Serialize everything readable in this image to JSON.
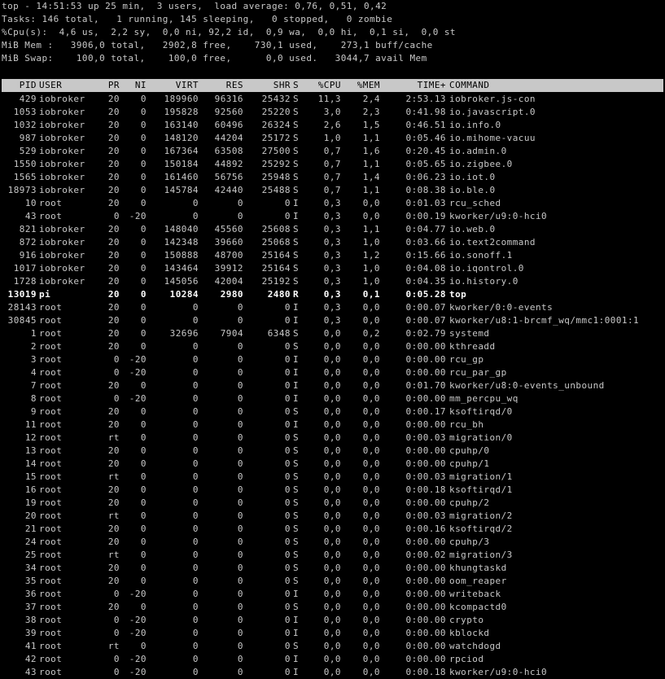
{
  "summary": {
    "uptime_line": "top - 14:51:53 up 25 min,  3 users,  load average: 0,76, 0,51, 0,42",
    "tasks_line": "Tasks: 146 total,   1 running, 145 sleeping,   0 stopped,   0 zombie",
    "cpu_line": "%Cpu(s):  4,6 us,  2,2 sy,  0,0 ni, 92,2 id,  0,9 wa,  0,0 hi,  0,1 si,  0,0 st",
    "mem_line": "MiB Mem :   3906,0 total,   2902,8 free,    730,1 used,    273,1 buff/cache",
    "swap_line": "MiB Swap:    100,0 total,    100,0 free,      0,0 used.   3044,7 avail Mem"
  },
  "columns": [
    "PID",
    "USER",
    "PR",
    "NI",
    "VIRT",
    "RES",
    "SHR",
    "S",
    "%CPU",
    "%MEM",
    "TIME+",
    "COMMAND"
  ],
  "processes": [
    [
      "429",
      "iobroker",
      "20",
      "0",
      "189960",
      "96316",
      "25432",
      "S",
      "11,3",
      "2,4",
      "2:53.13",
      "iobroker.js-con"
    ],
    [
      "1053",
      "iobroker",
      "20",
      "0",
      "195828",
      "92560",
      "25220",
      "S",
      "3,0",
      "2,3",
      "0:41.98",
      "io.javascript.0"
    ],
    [
      "1032",
      "iobroker",
      "20",
      "0",
      "163140",
      "60496",
      "26324",
      "S",
      "2,6",
      "1,5",
      "0:46.51",
      "io.info.0"
    ],
    [
      "987",
      "iobroker",
      "20",
      "0",
      "148120",
      "44204",
      "25172",
      "S",
      "1,0",
      "1,1",
      "0:05.46",
      "io.mihome-vacuu"
    ],
    [
      "529",
      "iobroker",
      "20",
      "0",
      "167364",
      "63508",
      "27500",
      "S",
      "0,7",
      "1,6",
      "0:20.45",
      "io.admin.0"
    ],
    [
      "1550",
      "iobroker",
      "20",
      "0",
      "150184",
      "44892",
      "25292",
      "S",
      "0,7",
      "1,1",
      "0:05.65",
      "io.zigbee.0"
    ],
    [
      "1565",
      "iobroker",
      "20",
      "0",
      "161460",
      "56756",
      "25948",
      "S",
      "0,7",
      "1,4",
      "0:06.23",
      "io.iot.0"
    ],
    [
      "18973",
      "iobroker",
      "20",
      "0",
      "145784",
      "42440",
      "25488",
      "S",
      "0,7",
      "1,1",
      "0:08.38",
      "io.ble.0"
    ],
    [
      "10",
      "root",
      "20",
      "0",
      "0",
      "0",
      "0",
      "I",
      "0,3",
      "0,0",
      "0:01.03",
      "rcu_sched"
    ],
    [
      "43",
      "root",
      "0",
      "-20",
      "0",
      "0",
      "0",
      "I",
      "0,3",
      "0,0",
      "0:00.19",
      "kworker/u9:0-hci0"
    ],
    [
      "821",
      "iobroker",
      "20",
      "0",
      "148040",
      "45560",
      "25608",
      "S",
      "0,3",
      "1,1",
      "0:04.77",
      "io.web.0"
    ],
    [
      "872",
      "iobroker",
      "20",
      "0",
      "142348",
      "39660",
      "25068",
      "S",
      "0,3",
      "1,0",
      "0:03.66",
      "io.text2command"
    ],
    [
      "916",
      "iobroker",
      "20",
      "0",
      "150888",
      "48700",
      "25164",
      "S",
      "0,3",
      "1,2",
      "0:15.66",
      "io.sonoff.1"
    ],
    [
      "1017",
      "iobroker",
      "20",
      "0",
      "143464",
      "39912",
      "25164",
      "S",
      "0,3",
      "1,0",
      "0:04.08",
      "io.iqontrol.0"
    ],
    [
      "1728",
      "iobroker",
      "20",
      "0",
      "145056",
      "42004",
      "25192",
      "S",
      "0,3",
      "1,0",
      "0:04.35",
      "io.history.0"
    ],
    [
      "13019",
      "pi",
      "20",
      "0",
      "10284",
      "2980",
      "2480",
      "R",
      "0,3",
      "0,1",
      "0:05.28",
      "top"
    ],
    [
      "28143",
      "root",
      "20",
      "0",
      "0",
      "0",
      "0",
      "I",
      "0,3",
      "0,0",
      "0:00.07",
      "kworker/0:0-events"
    ],
    [
      "30845",
      "root",
      "20",
      "0",
      "0",
      "0",
      "0",
      "I",
      "0,3",
      "0,0",
      "0:00.07",
      "kworker/u8:1-brcmf_wq/mmc1:0001:1"
    ],
    [
      "1",
      "root",
      "20",
      "0",
      "32696",
      "7904",
      "6348",
      "S",
      "0,0",
      "0,2",
      "0:02.79",
      "systemd"
    ],
    [
      "2",
      "root",
      "20",
      "0",
      "0",
      "0",
      "0",
      "S",
      "0,0",
      "0,0",
      "0:00.00",
      "kthreadd"
    ],
    [
      "3",
      "root",
      "0",
      "-20",
      "0",
      "0",
      "0",
      "I",
      "0,0",
      "0,0",
      "0:00.00",
      "rcu_gp"
    ],
    [
      "4",
      "root",
      "0",
      "-20",
      "0",
      "0",
      "0",
      "I",
      "0,0",
      "0,0",
      "0:00.00",
      "rcu_par_gp"
    ],
    [
      "7",
      "root",
      "20",
      "0",
      "0",
      "0",
      "0",
      "I",
      "0,0",
      "0,0",
      "0:01.70",
      "kworker/u8:0-events_unbound"
    ],
    [
      "8",
      "root",
      "0",
      "-20",
      "0",
      "0",
      "0",
      "I",
      "0,0",
      "0,0",
      "0:00.00",
      "mm_percpu_wq"
    ],
    [
      "9",
      "root",
      "20",
      "0",
      "0",
      "0",
      "0",
      "S",
      "0,0",
      "0,0",
      "0:00.17",
      "ksoftirqd/0"
    ],
    [
      "11",
      "root",
      "20",
      "0",
      "0",
      "0",
      "0",
      "I",
      "0,0",
      "0,0",
      "0:00.00",
      "rcu_bh"
    ],
    [
      "12",
      "root",
      "rt",
      "0",
      "0",
      "0",
      "0",
      "S",
      "0,0",
      "0,0",
      "0:00.03",
      "migration/0"
    ],
    [
      "13",
      "root",
      "20",
      "0",
      "0",
      "0",
      "0",
      "S",
      "0,0",
      "0,0",
      "0:00.00",
      "cpuhp/0"
    ],
    [
      "14",
      "root",
      "20",
      "0",
      "0",
      "0",
      "0",
      "S",
      "0,0",
      "0,0",
      "0:00.00",
      "cpuhp/1"
    ],
    [
      "15",
      "root",
      "rt",
      "0",
      "0",
      "0",
      "0",
      "S",
      "0,0",
      "0,0",
      "0:00.03",
      "migration/1"
    ],
    [
      "16",
      "root",
      "20",
      "0",
      "0",
      "0",
      "0",
      "S",
      "0,0",
      "0,0",
      "0:00.18",
      "ksoftirqd/1"
    ],
    [
      "19",
      "root",
      "20",
      "0",
      "0",
      "0",
      "0",
      "S",
      "0,0",
      "0,0",
      "0:00.00",
      "cpuhp/2"
    ],
    [
      "20",
      "root",
      "rt",
      "0",
      "0",
      "0",
      "0",
      "S",
      "0,0",
      "0,0",
      "0:00.03",
      "migration/2"
    ],
    [
      "21",
      "root",
      "20",
      "0",
      "0",
      "0",
      "0",
      "S",
      "0,0",
      "0,0",
      "0:00.16",
      "ksoftirqd/2"
    ],
    [
      "24",
      "root",
      "20",
      "0",
      "0",
      "0",
      "0",
      "S",
      "0,0",
      "0,0",
      "0:00.00",
      "cpuhp/3"
    ],
    [
      "25",
      "root",
      "rt",
      "0",
      "0",
      "0",
      "0",
      "S",
      "0,0",
      "0,0",
      "0:00.02",
      "migration/3"
    ],
    [
      "34",
      "root",
      "20",
      "0",
      "0",
      "0",
      "0",
      "S",
      "0,0",
      "0,0",
      "0:00.00",
      "khungtaskd"
    ],
    [
      "35",
      "root",
      "20",
      "0",
      "0",
      "0",
      "0",
      "S",
      "0,0",
      "0,0",
      "0:00.00",
      "oom_reaper"
    ],
    [
      "36",
      "root",
      "0",
      "-20",
      "0",
      "0",
      "0",
      "I",
      "0,0",
      "0,0",
      "0:00.00",
      "writeback"
    ],
    [
      "37",
      "root",
      "20",
      "0",
      "0",
      "0",
      "0",
      "S",
      "0,0",
      "0,0",
      "0:00.00",
      "kcompactd0"
    ],
    [
      "38",
      "root",
      "0",
      "-20",
      "0",
      "0",
      "0",
      "I",
      "0,0",
      "0,0",
      "0:00.00",
      "crypto"
    ],
    [
      "39",
      "root",
      "0",
      "-20",
      "0",
      "0",
      "0",
      "I",
      "0,0",
      "0,0",
      "0:00.00",
      "kblockd"
    ],
    [
      "41",
      "root",
      "rt",
      "0",
      "0",
      "0",
      "0",
      "S",
      "0,0",
      "0,0",
      "0:00.00",
      "watchdogd"
    ],
    [
      "42",
      "root",
      "0",
      "-20",
      "0",
      "0",
      "0",
      "I",
      "0,0",
      "0,0",
      "0:00.00",
      "rpciod"
    ],
    [
      "43",
      "root",
      "0",
      "-20",
      "0",
      "0",
      "0",
      "I",
      "0,0",
      "0,0",
      "0:00.18",
      "kworker/u9:0-hci0"
    ]
  ],
  "colors": {
    "background": "#000000",
    "text": "#c8c8c8",
    "header_background": "#c8c8c8",
    "header_text": "#000000",
    "running_text": "#ffffff"
  }
}
